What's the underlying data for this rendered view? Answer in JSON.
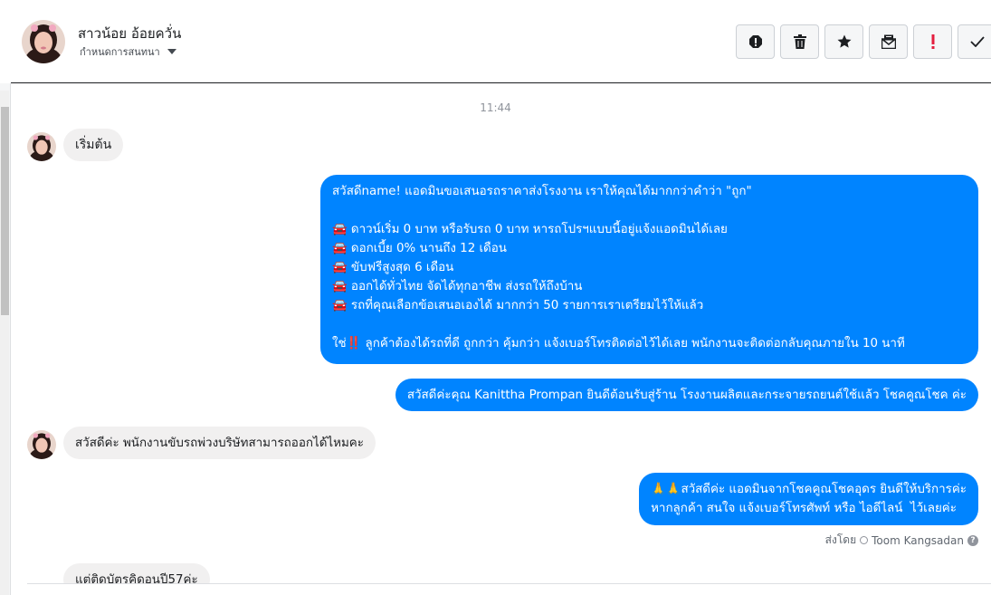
{
  "header": {
    "contact_name": "สาวน้อย อ้อยควั่น",
    "assign_label": "กำหนดการสนทนา",
    "actions": [
      {
        "name": "report-icon",
        "glyph": "!"
      },
      {
        "name": "trash-icon"
      },
      {
        "name": "star-icon"
      },
      {
        "name": "mark-unread-icon"
      },
      {
        "name": "important-icon",
        "glyph": "!"
      },
      {
        "name": "check-icon"
      }
    ]
  },
  "conversation": {
    "timestamp": "11:44",
    "messages": [
      {
        "direction": "in",
        "text": "เริ่มต้น"
      },
      {
        "direction": "out",
        "text": "สวัสดีname! แอดมินขอเสนอรถราคาส่งโรงงาน เราให้คุณได้มากกว่าคำว่า \"ถูก\"\n\n🚘 ดาวน์เริ่ม 0 บาท หรือรับรถ 0 บาท หารถโปรฯแบบนี้อยู่แจ้งแอดมินได้เลย\n🚘 ดอกเบี้ย 0% นานถึง 12 เดือน\n🚘 ขับฟรีสูงสุด 6 เดือน\n🚘 ออกได้ทั่วไทย จัดได้ทุกอาชีพ ส่งรถให้ถึงบ้าน\n🚘 รถที่คุณเลือกข้อเสนอเองได้ มากกว่า 50 รายการเราเตรียมไว้ให้แล้ว\n\nใช่‼️ ลูกค้าต้องได้รถที่ดี ถูกกว่า คุ้มกว่า แจ้งเบอร์โทรติดต่อไว้ได้เลย พนักงานจะติดต่อกลับคุณภายใน 10 นาที"
      },
      {
        "direction": "out",
        "text": "สวัสดีค่ะคุณ Kanittha Prompan ยินดีต้อนรับสู่ร้าน โรงงานผลิตและกระจายรถยนต์ใช้แล้ว โชคคูณโชค ค่ะ"
      },
      {
        "direction": "in",
        "text": "สวัสดีค่ะ พนักงานขับรถพ่วงบริษัทสามารถออกได้ไหมคะ"
      },
      {
        "direction": "out",
        "text": "🙏🙏สวัสดีค่ะ แอดมินจากโชคคูณโชคอุดร ยินดีให้บริการค่ะ\nหากลูกค้า สนใจ แจ้งเบอร์โทรศัพท์ หรือ ไอดีไลน์  ไว้เลยค่ะ"
      },
      {
        "direction": "in",
        "text": "แต่ติดบัตรคิดอนปี57ค่ะ"
      }
    ],
    "sent_by_label": "ส่งโดย",
    "sent_by_name": "Toom Kangsadan"
  },
  "colors": {
    "outgoing_bubble": "#0084ff",
    "incoming_bubble": "#f1f0f0",
    "important_icon": "#e41e3f"
  }
}
